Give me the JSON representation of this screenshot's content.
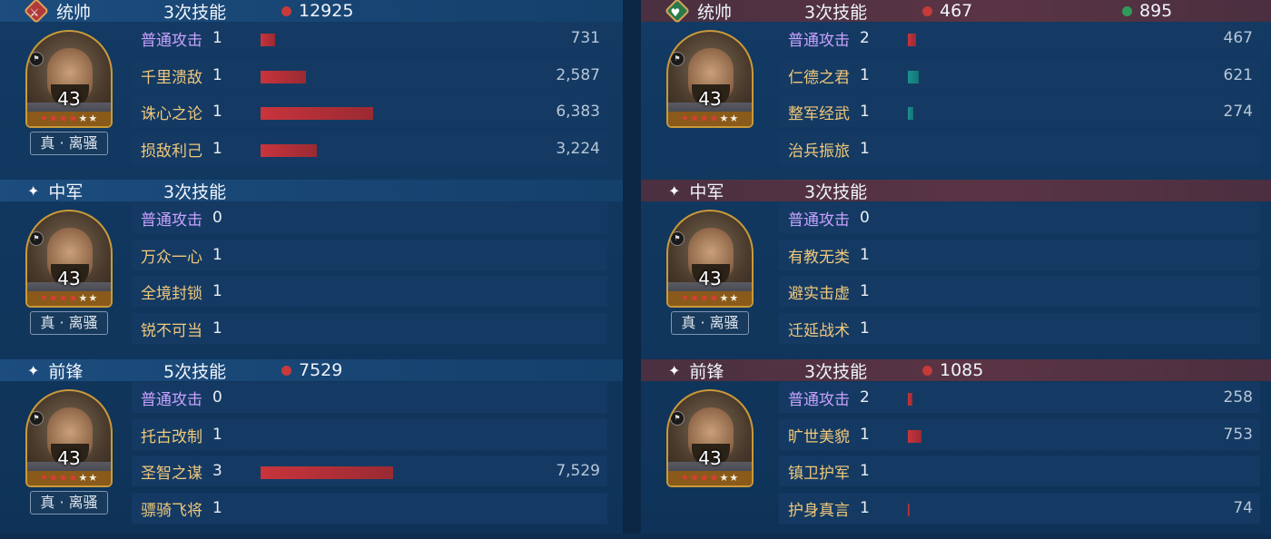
{
  "left": [
    {
      "role": "统帅",
      "role_icon": "red-badge",
      "count": "3次技能",
      "stat1": "12925",
      "stat2": "",
      "level": "43",
      "tag": "真 · 离骚",
      "skills": [
        {
          "name": "普通攻击",
          "lvl": "1",
          "value": "731",
          "pct": 0.025,
          "color": "red"
        },
        {
          "name": "千里溃敌",
          "lvl": "1",
          "value": "2,587",
          "pct": 0.08,
          "color": "red"
        },
        {
          "name": "诛心之论",
          "lvl": "1",
          "value": "6,383",
          "pct": 0.2,
          "color": "red"
        },
        {
          "name": "损敌利己",
          "lvl": "1",
          "value": "3,224",
          "pct": 0.1,
          "color": "red"
        }
      ]
    },
    {
      "role": "中军",
      "count": "3次技能",
      "stat1": "",
      "stat2": "",
      "level": "43",
      "tag": "真 · 离骚",
      "skills": [
        {
          "name": "普通攻击",
          "lvl": "0",
          "value": "",
          "pct": 0,
          "color": "red"
        },
        {
          "name": "万众一心",
          "lvl": "1",
          "value": "",
          "pct": 0,
          "color": "red"
        },
        {
          "name": "全境封锁",
          "lvl": "1",
          "value": "",
          "pct": 0,
          "color": "red"
        },
        {
          "name": "锐不可当",
          "lvl": "1",
          "value": "",
          "pct": 0,
          "color": "red"
        }
      ]
    },
    {
      "role": "前锋",
      "count": "5次技能",
      "stat1": "7529",
      "stat2": "",
      "level": "43",
      "tag": "真 · 离骚",
      "skills": [
        {
          "name": "普通攻击",
          "lvl": "0",
          "value": "",
          "pct": 0,
          "color": "red"
        },
        {
          "name": "托古改制",
          "lvl": "1",
          "value": "",
          "pct": 0,
          "color": "red"
        },
        {
          "name": "圣智之谋",
          "lvl": "3",
          "value": "7,529",
          "pct": 0.235,
          "color": "red"
        },
        {
          "name": "骠骑飞将",
          "lvl": "1",
          "value": "",
          "pct": 0,
          "color": "red"
        }
      ]
    }
  ],
  "right": [
    {
      "role": "统帅",
      "role_icon": "green-badge",
      "count": "3次技能",
      "stat1": "467",
      "stat2": "895",
      "level": "43",
      "tag": "",
      "skills": [
        {
          "name": "普通攻击",
          "lvl": "2",
          "value": "467",
          "pct": 0.015,
          "color": "red"
        },
        {
          "name": "仁德之君",
          "lvl": "1",
          "value": "621",
          "pct": 0.02,
          "color": "teal"
        },
        {
          "name": "整军经武",
          "lvl": "1",
          "value": "274",
          "pct": 0.009,
          "color": "teal"
        },
        {
          "name": "治兵振旅",
          "lvl": "1",
          "value": "",
          "pct": 0,
          "color": "red"
        }
      ]
    },
    {
      "role": "中军",
      "count": "3次技能",
      "stat1": "",
      "stat2": "",
      "level": "43",
      "tag": "真 · 离骚",
      "skills": [
        {
          "name": "普通攻击",
          "lvl": "0",
          "value": "",
          "pct": 0,
          "color": "red"
        },
        {
          "name": "有教无类",
          "lvl": "1",
          "value": "",
          "pct": 0,
          "color": "red"
        },
        {
          "name": "避实击虚",
          "lvl": "1",
          "value": "",
          "pct": 0,
          "color": "red"
        },
        {
          "name": "迁延战术",
          "lvl": "1",
          "value": "",
          "pct": 0,
          "color": "red"
        }
      ]
    },
    {
      "role": "前锋",
      "count": "3次技能",
      "stat1": "1085",
      "stat2": "",
      "level": "43",
      "tag": "",
      "skills": [
        {
          "name": "普通攻击",
          "lvl": "2",
          "value": "258",
          "pct": 0.008,
          "color": "red"
        },
        {
          "name": "旷世美貌",
          "lvl": "1",
          "value": "753",
          "pct": 0.024,
          "color": "red"
        },
        {
          "name": "镇卫护军",
          "lvl": "1",
          "value": "",
          "pct": 0,
          "color": "red"
        },
        {
          "name": "护身真言",
          "lvl": "1",
          "value": "74",
          "pct": 0.003,
          "color": "red"
        }
      ]
    }
  ],
  "stars": "★★★★★",
  "colors": {
    "damage": "#c8343c",
    "heal": "#1c8f8f",
    "accent_gold": "#c99a3a"
  }
}
